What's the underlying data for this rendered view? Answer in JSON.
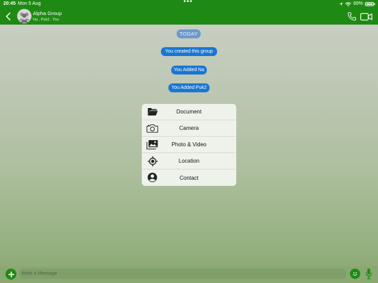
{
  "status_bar": {
    "time": "20:45",
    "date": "Mon 5 Aug",
    "battery": "89%"
  },
  "header": {
    "title": "Alpha Group",
    "subtitle": "Na , Puk2 , You"
  },
  "chat": {
    "date_label": "TODAY",
    "messages": [
      "You created this group",
      "You Added Na",
      "You Added Puk2"
    ]
  },
  "attachment_menu": {
    "items": [
      {
        "label": "Document",
        "icon": "folder-icon"
      },
      {
        "label": "Camera",
        "icon": "camera-icon"
      },
      {
        "label": "Photo & Video",
        "icon": "photo-icon"
      },
      {
        "label": "Location",
        "icon": "location-icon"
      },
      {
        "label": "Contact",
        "icon": "contact-icon"
      }
    ]
  },
  "composer": {
    "placeholder": "Write a Message"
  },
  "colors": {
    "header_bg": "#1f8a13",
    "bubble_blue": "#1976d2",
    "menu_bg": "#eef2ea"
  }
}
